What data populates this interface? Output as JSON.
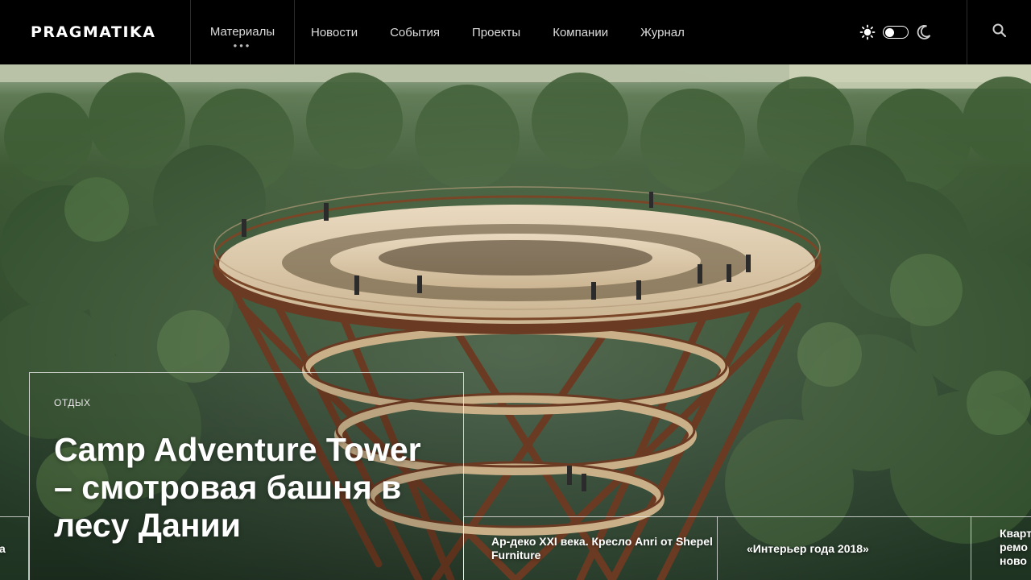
{
  "brand": {
    "logo": "PRAGMATIKA"
  },
  "nav": {
    "items": [
      {
        "label": "Материалы",
        "more": "•••"
      },
      {
        "label": "Новости"
      },
      {
        "label": "События"
      },
      {
        "label": "Проекты"
      },
      {
        "label": "Компании"
      },
      {
        "label": "Журнал"
      }
    ]
  },
  "theme": {
    "light_icon": "sun-icon",
    "dark_icon": "moon-icon",
    "mode": "light"
  },
  "search": {
    "icon": "search-icon"
  },
  "feature": {
    "category": "ОТДЫХ",
    "title": "Camp Adventure Tower – смотровая башня в лесу Дании"
  },
  "ticker": [
    {
      "text": "а"
    },
    {
      "text": "Ар-деко XXI века. Кресло Anri от Shepel Furniture"
    },
    {
      "text": "«Интерьер года 2018»"
    },
    {
      "text": "Кварт ремо ново"
    }
  ],
  "colors": {
    "header_bg": "#000000",
    "text": "#ffffff",
    "tower": "#6b3a22"
  }
}
